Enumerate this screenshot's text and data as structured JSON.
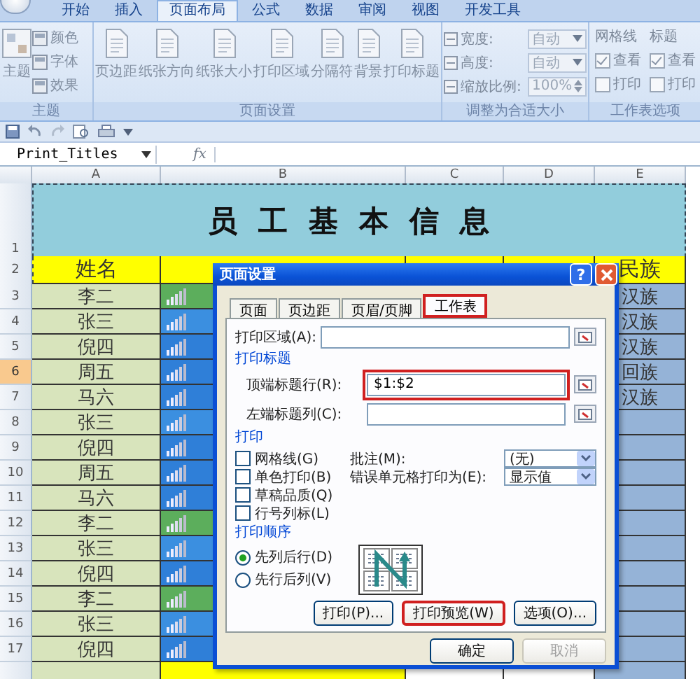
{
  "ribbon": {
    "tabs": [
      {
        "label": "开始",
        "selected": false
      },
      {
        "label": "插入",
        "selected": false
      },
      {
        "label": "页面布局",
        "selected": true
      },
      {
        "label": "公式",
        "selected": false
      },
      {
        "label": "数据",
        "selected": false
      },
      {
        "label": "审阅",
        "selected": false
      },
      {
        "label": "视图",
        "selected": false
      },
      {
        "label": "开发工具",
        "selected": false
      }
    ],
    "groups": [
      {
        "kind": "theme",
        "title": "主题",
        "big": "主题",
        "items": [
          "颜色",
          "字体",
          "效果"
        ]
      },
      {
        "kind": "buttons",
        "title": "页面设置",
        "items": [
          "页边距",
          "纸张方向",
          "纸张大小",
          "打印区域",
          "分隔符",
          "背景",
          "打印标题"
        ]
      },
      {
        "kind": "fit",
        "title": "调整为合适大小",
        "rows": [
          {
            "kind": "dropdown",
            "label": "宽度:",
            "value": "自动"
          },
          {
            "kind": "dropdown",
            "label": "高度:",
            "value": "自动"
          },
          {
            "kind": "spinner",
            "label": "缩放比例:",
            "value": "100%"
          }
        ]
      },
      {
        "kind": "options",
        "title": "工作表选项",
        "columns": [
          {
            "heading": "网格线",
            "boxes": [
              {
                "label": "查看",
                "checked": true
              },
              {
                "label": "打印",
                "checked": false
              }
            ]
          },
          {
            "heading": "标题",
            "boxes": [
              {
                "label": "查看",
                "checked": true
              },
              {
                "label": "打印",
                "checked": false
              }
            ]
          }
        ]
      }
    ]
  },
  "formula_bar": {
    "name_box": "Print_Titles",
    "fx": "fx"
  },
  "sheet": {
    "columns": [
      "A",
      "B",
      "C",
      "D",
      "E"
    ],
    "title_row": {
      "number": "1",
      "title": "员工基本信息"
    },
    "header_row": {
      "number": "2",
      "name_heading": "姓名",
      "ethnicity_heading": "民族"
    },
    "rows": [
      {
        "number": "3",
        "name": "李二",
        "color": "#5cae5c",
        "ethnicity": "汉族",
        "selected": false
      },
      {
        "number": "4",
        "name": "张三",
        "color": "#3b8fe0",
        "ethnicity": "汉族",
        "selected": false
      },
      {
        "number": "5",
        "name": "倪四",
        "color": "#2f7fd8",
        "ethnicity": "汉族",
        "selected": false
      },
      {
        "number": "6",
        "name": "周五",
        "color": "#2f7fd8",
        "ethnicity": "回族",
        "selected": true
      },
      {
        "number": "7",
        "name": "马六",
        "color": "#2f7fd8",
        "ethnicity": "汉族",
        "selected": false
      },
      {
        "number": "8",
        "name": "张三",
        "color": "#3b8fe0",
        "selected": false
      },
      {
        "number": "9",
        "name": "倪四",
        "color": "#2f7fd8",
        "selected": false
      },
      {
        "number": "10",
        "name": "周五",
        "color": "#2f7fd8",
        "selected": false
      },
      {
        "number": "11",
        "name": "马六",
        "color": "#2f7fd8",
        "selected": false
      },
      {
        "number": "12",
        "name": "李二",
        "color": "#5cae5c",
        "selected": false
      },
      {
        "number": "13",
        "name": "张三",
        "color": "#3b8fe0",
        "selected": false
      },
      {
        "number": "14",
        "name": "倪四",
        "color": "#2f7fd8",
        "selected": false
      },
      {
        "number": "15",
        "name": "李二",
        "color": "#5cae5c",
        "selected": false
      },
      {
        "number": "16",
        "name": "张三",
        "color": "#3b8fe0",
        "selected": false
      },
      {
        "number": "17",
        "name": "倪四",
        "color": "#2f7fd8",
        "selected": false
      }
    ]
  },
  "dialog": {
    "title": "页面设置",
    "help": "?",
    "tabs": [
      {
        "label": "页面",
        "selected": false,
        "marked": false
      },
      {
        "label": "页边距",
        "selected": false,
        "marked": false
      },
      {
        "label": "页眉/页脚",
        "selected": false,
        "marked": false
      },
      {
        "label": "工作表",
        "selected": true,
        "marked": true
      }
    ],
    "print_area": "打印区域(A):",
    "titles_section": "打印标题",
    "title_fields": [
      {
        "label": "顶端标题行(R):",
        "value": "$1:$2",
        "marked": true
      },
      {
        "label": "左端标题列(C):",
        "marked": false
      }
    ],
    "print_section": "打印",
    "options": [
      {
        "label": "网格线(G)",
        "checked": false
      },
      {
        "label": "单色打印(B)",
        "checked": false
      },
      {
        "label": "草稿品质(Q)",
        "checked": false
      },
      {
        "label": "行号列标(L)",
        "checked": false
      }
    ],
    "selects": [
      {
        "label": "批注(M):",
        "value": "(无)"
      },
      {
        "label": "错误单元格打印为(E):",
        "value": "显示值"
      }
    ],
    "order_section": "打印顺序",
    "order": [
      {
        "label": "先列后行(D)",
        "selected": true
      },
      {
        "label": "先行后列(V)",
        "selected": false
      }
    ],
    "buttons": [
      {
        "label": "打印(P)...",
        "marked": false
      },
      {
        "label": "打印预览(W)",
        "marked": true
      },
      {
        "label": "选项(O)...",
        "marked": false
      }
    ],
    "footer_buttons": [
      {
        "label": "确定",
        "disabled": false
      },
      {
        "label": "取消",
        "disabled": true
      }
    ]
  }
}
